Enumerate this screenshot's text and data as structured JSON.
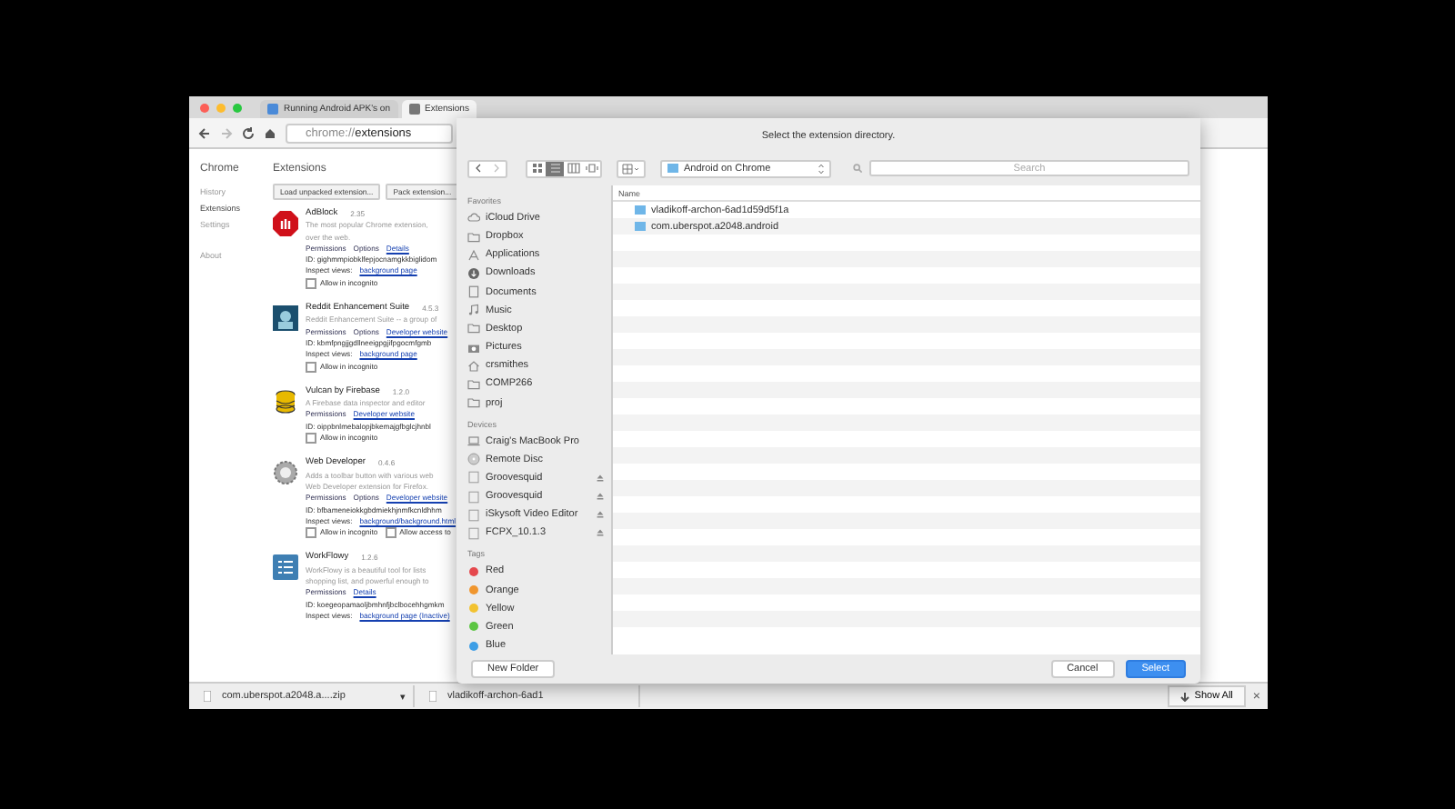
{
  "browser": {
    "tabs": [
      {
        "title": "Running Android APK's on",
        "selected": false
      },
      {
        "title": "Extensions",
        "selected": true
      }
    ],
    "url_scheme": "chrome://",
    "url_path": "extensions",
    "sidebar": {
      "title": "Chrome",
      "items": [
        {
          "label": "History",
          "selected": false
        },
        {
          "label": "Extensions",
          "selected": true
        },
        {
          "label": "Settings",
          "selected": false
        },
        {
          "label": "About",
          "selected": false
        }
      ]
    },
    "page": {
      "title": "Extensions",
      "buttons": [
        "Load unpacked extension...",
        "Pack extension..."
      ],
      "extensions": [
        {
          "kind": "adblock",
          "name": "AdBlock",
          "version": "2.35",
          "description": [
            "The most popular Chrome extension,",
            "over the web."
          ],
          "links": [
            "Permissions",
            "Options",
            "Details"
          ],
          "id": "ID: gighmmpiobklfepjocnamgkkbiglidom",
          "inspect_label": "Inspect views:",
          "inspect_link": "background page",
          "checks": [
            "Allow in incognito"
          ]
        },
        {
          "kind": "reddit",
          "name": "Reddit Enhancement Suite",
          "version": "4.5.3",
          "description": [
            "Reddit Enhancement Suite -- a group of"
          ],
          "links": [
            "Permissions",
            "Options",
            "Developer website"
          ],
          "id": "ID: kbmfpngjjgdllneeigpgjifpgocmfgmb",
          "inspect_label": "Inspect views:",
          "inspect_link": "background page",
          "checks": [
            "Allow in incognito"
          ]
        },
        {
          "kind": "vulcan",
          "name": "Vulcan by Firebase",
          "version": "1.2.0",
          "description": [
            "A Firebase data inspector and editor"
          ],
          "links": [
            "Permissions",
            "Developer website"
          ],
          "id": "ID: oippbnlmebalopjbkemajgfbglcjhnbl",
          "checks": [
            "Allow in incognito"
          ]
        },
        {
          "kind": "webdev",
          "name": "Web Developer",
          "version": "0.4.6",
          "description": [
            "Adds a toolbar button with various web",
            "Web Developer extension for Firefox."
          ],
          "links": [
            "Permissions",
            "Options",
            "Developer website"
          ],
          "id": "ID: bfbameneiokkgbdmiekhjnmfkcnldhhm",
          "inspect_label": "Inspect views:",
          "inspect_link": "background/background.html",
          "checks": [
            "Allow in incognito",
            "Allow access to"
          ]
        },
        {
          "kind": "workflowy",
          "name": "WorkFlowy",
          "version": "1.2.6",
          "description": [
            "WorkFlowy is a beautiful tool for lists",
            "shopping list, and powerful enough to"
          ],
          "links": [
            "Permissions",
            "Details"
          ],
          "id": "ID: koegeopamaoljbmhnfjbclbocehhgmkm",
          "inspect_label": "Inspect views:",
          "inspect_link": "background page (Inactive)"
        }
      ]
    },
    "downloads": [
      {
        "name": "com.uberspot.a2048.a....zip",
        "caret": "▾"
      },
      {
        "name": "vladikoff-archon-6ad1"
      }
    ],
    "show_all": "Show All",
    "close": "×"
  },
  "dialog": {
    "title": "Select the extension directory.",
    "views": [
      {
        "kind": "icon",
        "selected": false
      },
      {
        "kind": "list",
        "selected": true
      },
      {
        "kind": "column",
        "selected": false
      },
      {
        "kind": "cover",
        "selected": false
      }
    ],
    "location": "Android on Chrome",
    "search_placeholder": "Search",
    "sections": [
      {
        "heading": "Favorites",
        "items": [
          {
            "label": "iCloud Drive",
            "kind": "cloud"
          },
          {
            "label": "Dropbox",
            "kind": "folder"
          },
          {
            "label": "Applications",
            "kind": "apps"
          },
          {
            "label": "Downloads",
            "kind": "downloads"
          },
          {
            "label": "Documents",
            "kind": "documents"
          },
          {
            "label": "Music",
            "kind": "music"
          },
          {
            "label": "Desktop",
            "kind": "folder"
          },
          {
            "label": "Pictures",
            "kind": "camera"
          },
          {
            "label": "crsmithes",
            "kind": "home"
          },
          {
            "label": "COMP266",
            "kind": "folder"
          },
          {
            "label": "proj",
            "kind": "folder"
          }
        ]
      },
      {
        "heading": "Devices",
        "items": [
          {
            "label": "Craig's MacBook Pro",
            "kind": "laptop"
          },
          {
            "label": "Remote Disc",
            "kind": "disc"
          },
          {
            "label": "Groovesquid",
            "kind": "drive",
            "eject": true
          },
          {
            "label": "Groovesquid",
            "kind": "drive",
            "eject": true
          },
          {
            "label": "iSkysoft Video Editor",
            "kind": "drive",
            "eject": true
          },
          {
            "label": "FCPX_10.1.3",
            "kind": "drive",
            "eject": true
          }
        ]
      },
      {
        "heading": "Tags",
        "items": [
          {
            "label": "Red",
            "kind": "tag",
            "color": "#e5484d"
          },
          {
            "label": "Orange",
            "kind": "tag",
            "color": "#f0962e"
          },
          {
            "label": "Yellow",
            "kind": "tag",
            "color": "#f2c230"
          },
          {
            "label": "Green",
            "kind": "tag",
            "color": "#5cc542"
          },
          {
            "label": "Blue",
            "kind": "tag",
            "color": "#3d9ee6"
          }
        ]
      }
    ],
    "column": "Name",
    "files": [
      "vladikoff-archon-6ad1d59d5f1a",
      "com.uberspot.a2048.android"
    ],
    "new_folder": "New Folder",
    "cancel": "Cancel",
    "select": "Select"
  }
}
